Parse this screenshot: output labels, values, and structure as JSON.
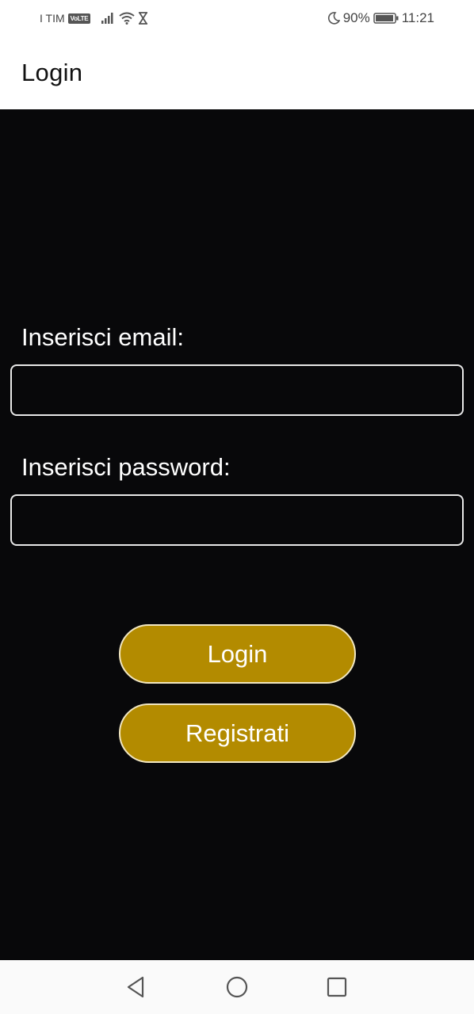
{
  "status_bar": {
    "carrier": "I TIM",
    "volte": "VoLTE",
    "battery": "90%",
    "time": "11:21",
    "icons": [
      "signal-icon",
      "wifi-icon",
      "hourglass-icon",
      "moon-icon",
      "battery-icon"
    ]
  },
  "app_bar": {
    "title": "Login"
  },
  "form": {
    "email_label": "Inserisci email:",
    "email_value": "",
    "password_label": "Inserisci password:",
    "password_value": "",
    "login_button": "Login",
    "register_button": "Registrati"
  },
  "nav_bar": {
    "icons": [
      "back-icon",
      "home-icon",
      "recents-icon"
    ]
  },
  "colors": {
    "background": "#08080a",
    "button": "#b38b00",
    "button_border": "#f2e7c2",
    "input_border": "#e8e8e8"
  }
}
